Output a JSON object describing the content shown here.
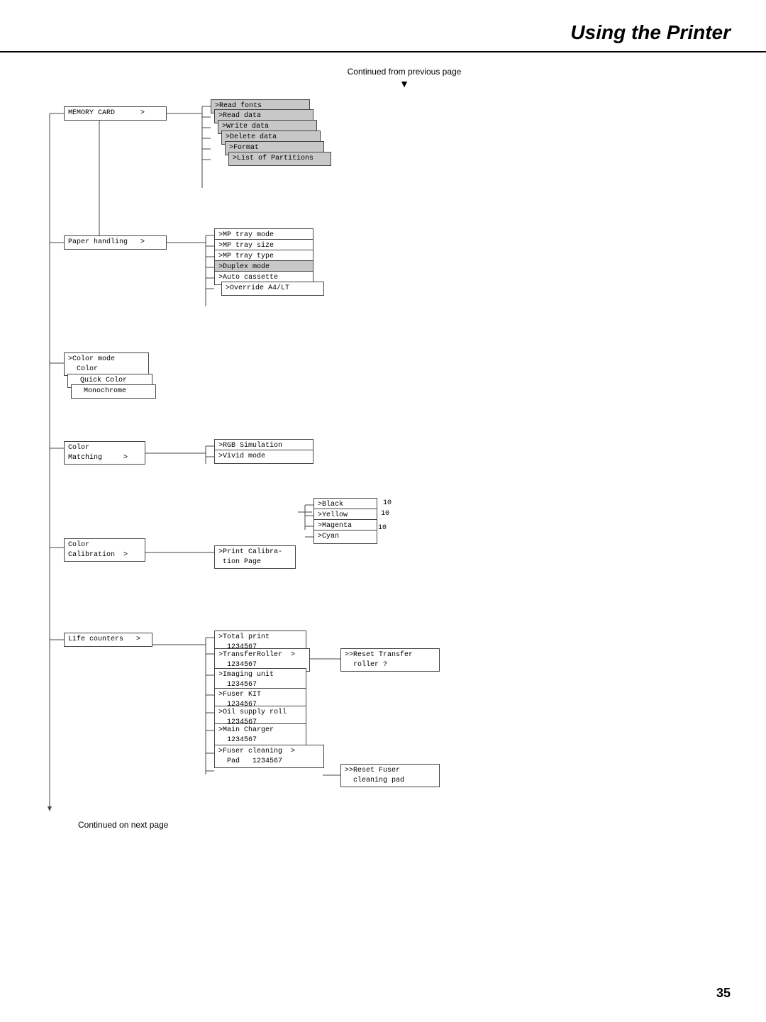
{
  "page": {
    "title": "Using the Printer",
    "page_number": "35",
    "continued_from": "Continued from previous page",
    "continued_next": "Continued on next page"
  },
  "nodes": {
    "memory_card": "MEMORY CARD      >",
    "read_fonts": ">Read fonts",
    "read_data": ">Read data",
    "write_data": ">Write data",
    "delete_data": ">Delete data",
    "format": ">Format",
    "list_partitions": ">List of Partitions",
    "paper_handling": "Paper handling   >",
    "mp_tray_mode": ">MP tray mode",
    "mp_tray_size": ">MP tray size",
    "mp_tray_type": ">MP tray type",
    "duplex_mode": ">Duplex mode",
    "auto_cassette": ">Auto cassette",
    "override_a4": ">Override A4/LT",
    "color_mode": ">Color mode\n  Color",
    "quick_color": "  Quick Color",
    "monochrome": "  Monochrome",
    "color_matching": "Color\nMatching     >",
    "rgb_simulation": ">RGB Simulation",
    "vivid_mode": ">Vivid mode",
    "black": ">Black",
    "yellow": ">Yellow",
    "magenta": ">Magenta",
    "cyan": ">Cyan",
    "num_10a": "10",
    "num_10b": "10",
    "num_10c": "10",
    "color_calibration": "Color\nCalibration  >",
    "print_calibration": ">Print Calibra-\n tion Page",
    "life_counters": "Life counters   >",
    "total_print": ">Total print\n  1234567",
    "transfer_roller": ">TransferRoller  >\n  1234567",
    "reset_transfer": ">>Reset Transfer\n  roller ?",
    "imaging_unit": ">Imaging unit\n  1234567",
    "fuser_kit": ">Fuser KIT\n  1234567",
    "oil_supply": ">Oil supply roll\n  1234567",
    "main_charger": ">Main Charger\n  1234567",
    "fuser_cleaning": ">Fuser cleaning  >\n  Pad   1234567",
    "reset_fuser": ">>Reset Fuser\n  cleaning pad"
  }
}
